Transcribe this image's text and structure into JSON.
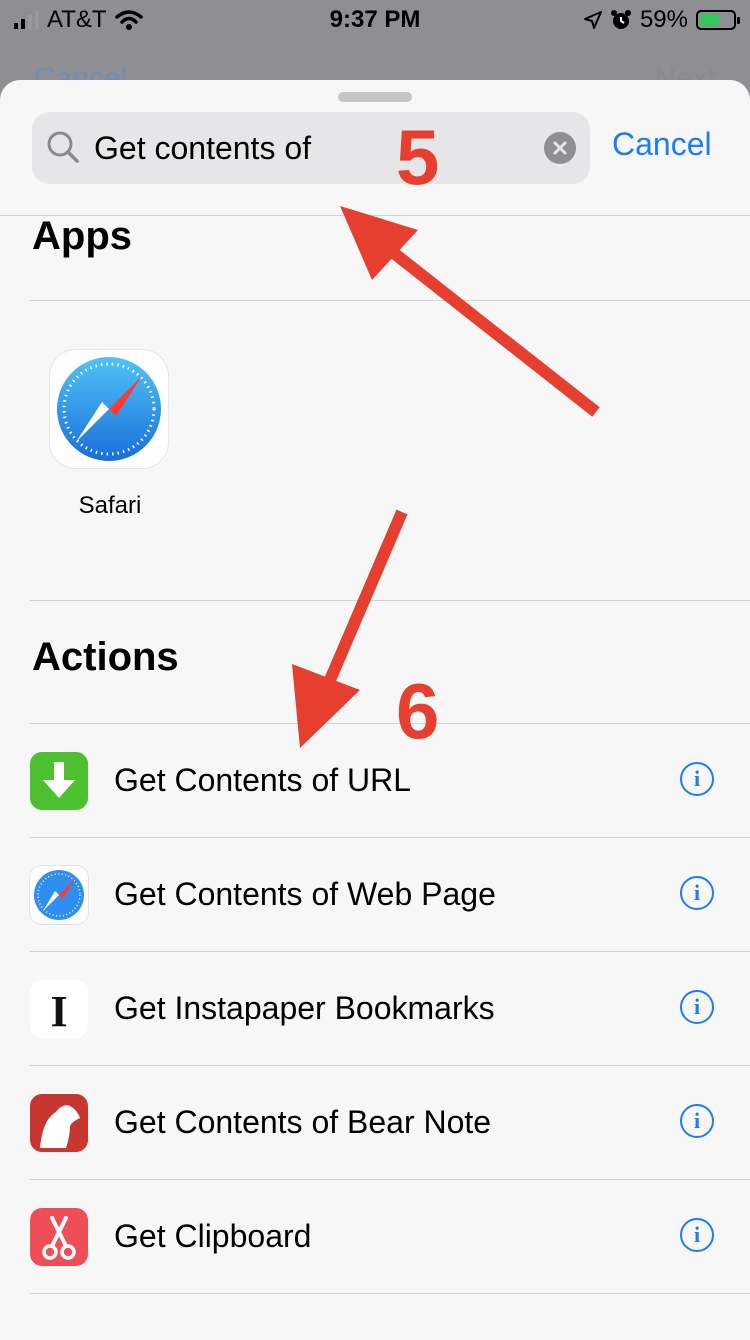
{
  "status_bar": {
    "carrier": "AT&T",
    "time": "9:37 PM",
    "battery": "59%",
    "battery_level": 0.59
  },
  "behind": {
    "left_button": "Cancel",
    "right_button": "Next"
  },
  "search": {
    "value": "Get contents of",
    "cancel_label": "Cancel"
  },
  "apps": {
    "title": "Apps",
    "items": [
      {
        "label": "Safari",
        "icon": "safari-icon"
      }
    ]
  },
  "actions": {
    "title": "Actions",
    "items": [
      {
        "label": "Get Contents of URL",
        "icon": "download-arrow-icon",
        "color": "#4cc02f"
      },
      {
        "label": "Get Contents of Web Page",
        "icon": "safari-icon",
        "color": "#2f8ff0"
      },
      {
        "label": "Get Instapaper Bookmarks",
        "icon": "instapaper-icon",
        "color": "#ffffff"
      },
      {
        "label": "Get Contents of Bear Note",
        "icon": "bear-icon",
        "color": "#c8362f"
      },
      {
        "label": "Get Clipboard",
        "icon": "scissors-icon",
        "color": "#ee4f57"
      }
    ]
  },
  "annotations": {
    "step_5": "5",
    "step_6": "6",
    "color": "#e63e2f"
  },
  "colors": {
    "accent": "#1d7cf2",
    "sheet_bg": "#f7f7f7"
  }
}
